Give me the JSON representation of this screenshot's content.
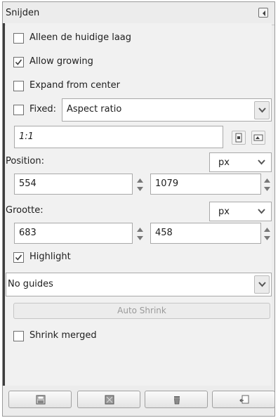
{
  "panel": {
    "title": "Snijden",
    "menu_icon": "tab-menu-icon"
  },
  "options": {
    "current_layer_only": {
      "label": "Alleen de huidige laag",
      "checked": false
    },
    "allow_growing": {
      "label": "Allow growing",
      "checked": true
    },
    "expand_from_center": {
      "label": "Expand from center",
      "checked": false
    },
    "fixed": {
      "label": "Fixed:",
      "checked": false,
      "mode": "Aspect ratio"
    },
    "ratio": {
      "value": "1:1"
    },
    "highlight": {
      "label": "Highlight",
      "checked": true
    },
    "shrink_merged": {
      "label": "Shrink merged",
      "checked": false
    }
  },
  "position": {
    "label": "Position:",
    "unit": "px",
    "x": "554",
    "y": "1079"
  },
  "size": {
    "label": "Grootte:",
    "unit": "px",
    "width": "683",
    "height": "458"
  },
  "guides": {
    "value": "No guides"
  },
  "auto_shrink": {
    "label": "Auto Shrink",
    "enabled": false
  },
  "footer_buttons": [
    "save-preset-icon",
    "restore-preset-icon",
    "delete-preset-icon",
    "reset-icon"
  ],
  "colors": {
    "panel_bg": "#ececec",
    "content_bg": "#f1f1f1",
    "border": "#a9a9a9",
    "disabled_text": "#9a9a9a"
  }
}
